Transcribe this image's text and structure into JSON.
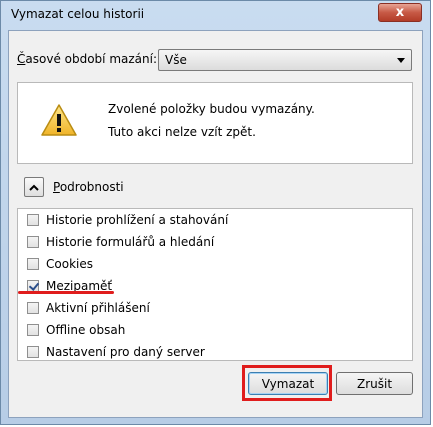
{
  "window": {
    "title": "Vymazat celou historii",
    "close_glyph": "x"
  },
  "time_range": {
    "label_pre": "Č",
    "label_rest": "asové období mazání:",
    "selected_value": "Vše"
  },
  "warning": {
    "icon": "warning-triangle-icon",
    "line1": "Zvolené položky budou vymazány.",
    "line2": "Tuto akci nelze vzít zpět."
  },
  "details": {
    "label_pre": "P",
    "label_rest": "odrobnosti",
    "expanded": true
  },
  "items": [
    {
      "label": "Historie prohlížení a stahování",
      "checked": false
    },
    {
      "label": "Historie formulářů a hledání",
      "checked": false
    },
    {
      "label": "Cookies",
      "checked": false
    },
    {
      "label": "Mezipaměť",
      "checked": true
    },
    {
      "label": "Aktivní přihlášení",
      "checked": false
    },
    {
      "label": "Offline obsah",
      "checked": false
    },
    {
      "label": "Nastavení pro daný server",
      "checked": false
    }
  ],
  "buttons": {
    "clear": "Vymazat",
    "cancel": "Zrušit"
  },
  "annotation_color": "#e01d1d"
}
